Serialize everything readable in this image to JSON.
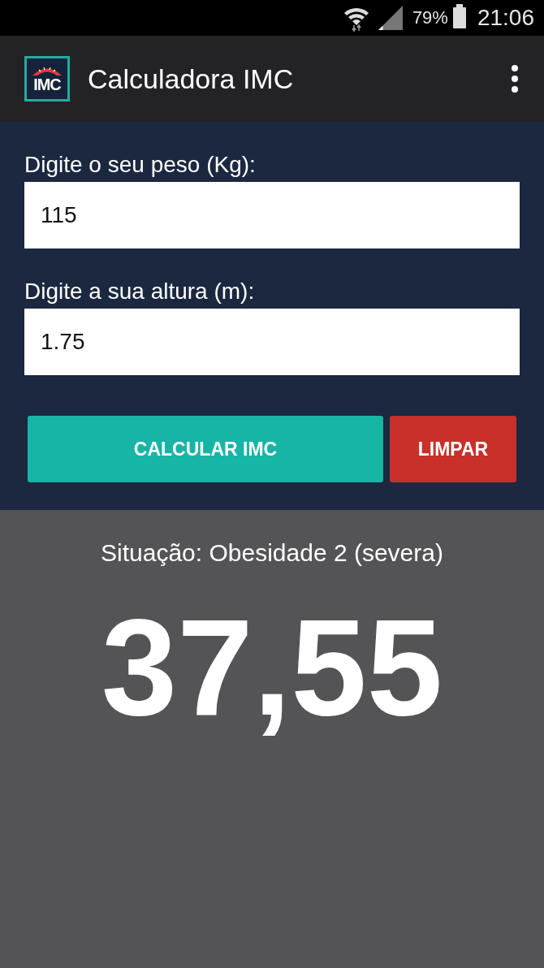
{
  "status_bar": {
    "battery": "79%",
    "time": "21:06"
  },
  "app_bar": {
    "logo_text": "IMC",
    "title": "Calculadora IMC"
  },
  "form": {
    "fields": [
      {
        "label": "Digite o seu peso (Kg):",
        "value": "115"
      },
      {
        "label": "Digite a sua altura (m):",
        "value": "1.75"
      }
    ],
    "buttons": [
      {
        "label": "CALCULAR IMC",
        "kind": "primary"
      },
      {
        "label": "LIMPAR",
        "kind": "danger"
      }
    ]
  },
  "result": {
    "situation": "Situação: Obesidade 2 (severa)",
    "value": "37,55"
  }
}
